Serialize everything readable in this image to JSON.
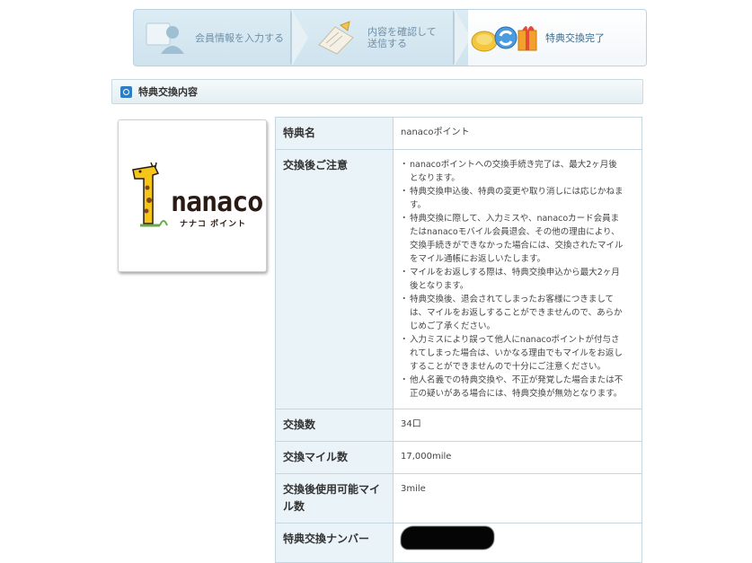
{
  "steps": [
    {
      "label": "会員情報を入力する",
      "icon": "user-icon"
    },
    {
      "label_line1": "内容を確認して",
      "label_line2": "送信する",
      "icon": "document-icon"
    },
    {
      "label": "特典交換完了",
      "icon": "coins-gift-icon",
      "active": true
    }
  ],
  "section": {
    "title": "特典交換内容"
  },
  "logo": {
    "text": "nanaco",
    "sub": "ナナコ ポイント"
  },
  "details": {
    "reward_name": {
      "label": "特典名",
      "value": "nanacoポイント"
    },
    "notes": {
      "label": "交換後ご注意",
      "items": [
        "nanacoポイントへの交換手続き完了は、最大2ヶ月後となります。",
        "特典交換申込後、特典の変更や取り消しには応じかねます。",
        "特典交換に際して、入力ミスや、nanacoカード会員またはnanacoモバイル会員退会、その他の理由により、交換手続きができなかった場合には、交換されたマイルをマイル通帳にお返しいたします。",
        "マイルをお返しする際は、特典交換申込から最大2ヶ月後となります。",
        "特典交換後、退会されてしまったお客様につきましては、マイルをお返しすることができませんので、あらかじめご了承ください。",
        "入力ミスにより誤って他人にnanacoポイントが付与されてしまった場合は、いかなる理由でもマイルをお返しすることができませんので十分にご注意ください。",
        "他人名義での特典交換や、不正が発覚した場合または不正の疑いがある場合には、特典交換が無効となります。"
      ]
    },
    "count": {
      "label": "交換数",
      "value": "34口"
    },
    "miles": {
      "label": "交換マイル数",
      "value": "17,000mile"
    },
    "remaining": {
      "label": "交換後使用可能マイル数",
      "value": "3mile"
    },
    "number": {
      "label": "特典交換ナンバー",
      "value": ""
    }
  },
  "colors": {
    "accent": "#2f7ec3",
    "header_cell": "#eaf3f8",
    "border": "#c6d6de",
    "stepbar": "#d5e7f0"
  }
}
